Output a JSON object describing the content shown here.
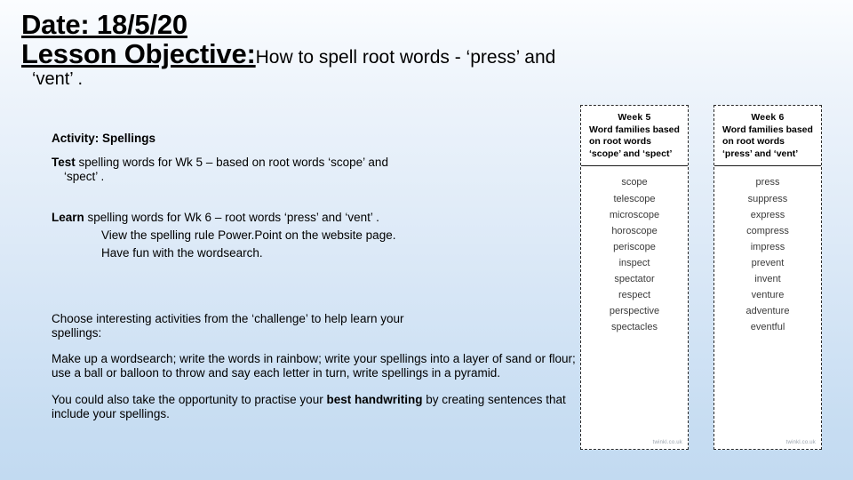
{
  "slide": {
    "background_top": "#fbfdff",
    "background_bottom": "#c2daf1"
  },
  "title": {
    "date_label": "Date: 18/5/20",
    "objective_label": "Lesson Objective:",
    "objective_text": "How to spell root words -   ‘press’   and",
    "objective_tail": "‘vent’ ."
  },
  "activity": {
    "heading": "Activity: Spellings",
    "test_bold": "Test",
    "test_text": " spelling words for Wk 5 – based on root words   ‘scope’   and",
    "test_tail": "‘spect’ .",
    "learn_bold": "Learn",
    "learn_text": " spelling words for Wk 6 – root words   ‘press’   and   ‘vent’ .",
    "learn_sub1": "View the spelling rule Power.Point on the website page.",
    "learn_sub2": "Have fun with the wordsearch.",
    "choose_line1": "Choose interesting activities from the   ‘challenge’   to help learn your",
    "choose_line2": "spellings:",
    "ideas_text": "Make up a wordsearch; write the words in rainbow;  write your spellings into a layer of sand or flour; use a ball or balloon to throw and say each letter in turn, write spellings in a pyramid.",
    "practise_pre": "You could also take the opportunity to practise your ",
    "practise_bold": "best handwriting",
    "practise_post": " by creating sentences that include your spellings."
  },
  "cards": [
    {
      "week_label": "Week 5",
      "description": "Word families based on root words ‘scope’ and ‘spect’",
      "words": [
        "scope",
        "telescope",
        "microscope",
        "horoscope",
        "periscope",
        "inspect",
        "spectator",
        "respect",
        "perspective",
        "spectacles"
      ],
      "footer": "twinkl.co.uk"
    },
    {
      "week_label": "Week 6",
      "description": "Word families based on root words ‘press’ and ‘vent’",
      "words": [
        "press",
        "suppress",
        "express",
        "compress",
        "impress",
        "prevent",
        "invent",
        "venture",
        "adventure",
        "eventful"
      ],
      "footer": "twinkl.co.uk"
    }
  ]
}
